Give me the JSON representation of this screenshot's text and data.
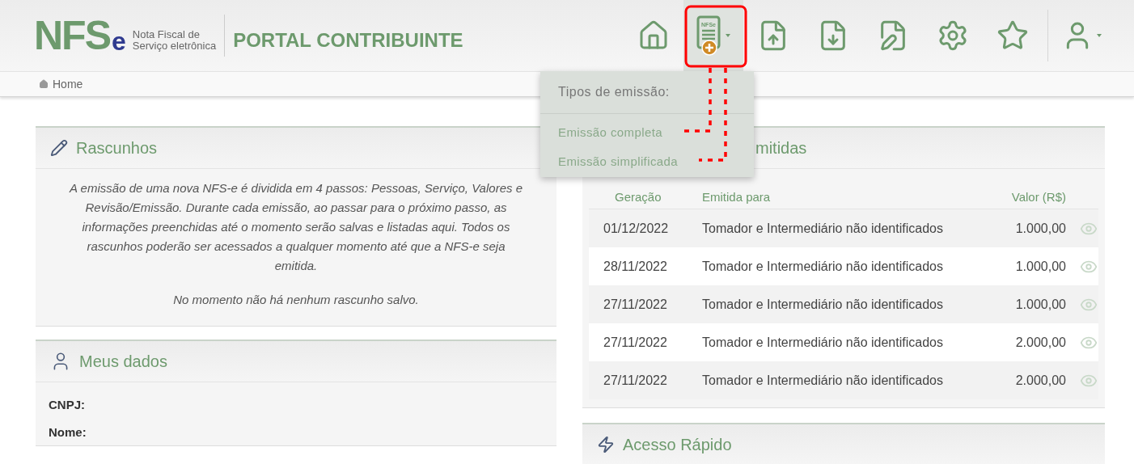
{
  "header": {
    "logo": {
      "letters": "NFS",
      "suffix": "e",
      "tagline": [
        "Nota Fiscal de",
        "Serviço eletrônica"
      ]
    },
    "portal_title": "PORTAL CONTRIBUINTE",
    "toolbar": [
      {
        "kind": "home"
      },
      {
        "kind": "new_nfse",
        "badge_text": "NFSe",
        "highlighted": true
      },
      {
        "kind": "upload"
      },
      {
        "kind": "download"
      },
      {
        "kind": "edit"
      },
      {
        "kind": "settings"
      },
      {
        "kind": "favorites"
      },
      {
        "kind": "user"
      }
    ]
  },
  "breadcrumb": [
    "Home"
  ],
  "dropdown": {
    "title": "Tipos de emissão:",
    "items": [
      "Emissão completa",
      "Emissão simplificada"
    ]
  },
  "drafts": {
    "title": "Rascunhos",
    "description": "A emissão de uma nova NFS-e é dividida em 4 passos: Pessoas, Serviço, Valores e Revisão/Emissão. Durante cada emissão, ao passar para o próximo passo, as informações preenchidas até o momento serão salvas e listadas aqui. Todos os rascunhos poderão ser acessados a qualquer momento até que a NFS-e seja emitida.",
    "empty_message": "No momento não há nenhum rascunho salvo."
  },
  "my_data": {
    "title": "Meus dados",
    "fields": [
      "CNPJ:",
      "Nome:"
    ]
  },
  "issued": {
    "title": "mitidas",
    "columns": [
      "Geração",
      "Emitida para",
      "Valor (R$)"
    ],
    "rows": [
      {
        "date": "01/12/2022",
        "recipient": "Tomador e Intermediário não identificados",
        "value": "1.000,00"
      },
      {
        "date": "28/11/2022",
        "recipient": "Tomador e Intermediário não identificados",
        "value": "1.000,00"
      },
      {
        "date": "27/11/2022",
        "recipient": "Tomador e Intermediário não identificados",
        "value": "1.000,00"
      },
      {
        "date": "27/11/2022",
        "recipient": "Tomador e Intermediário não identificados",
        "value": "2.000,00"
      },
      {
        "date": "27/11/2022",
        "recipient": "Tomador e Intermediário não identificados",
        "value": "2.000,00"
      }
    ]
  },
  "quick_access": {
    "title": "Acesso Rápido"
  }
}
